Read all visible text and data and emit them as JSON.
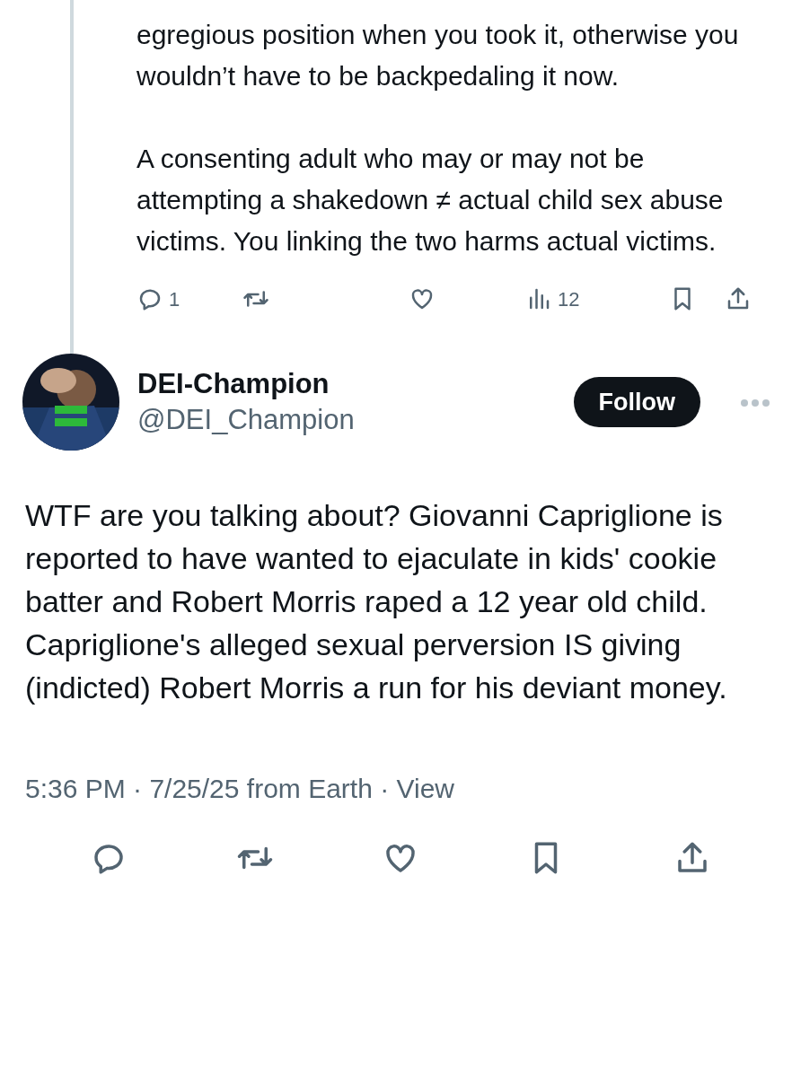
{
  "reply": {
    "paragraphs": [
      "egregious position when you took it, otherwise you wouldn’t have to be backpedaling it now.",
      "A consenting adult who may or may not be attempting a shakedown ≠ actual child sex abuse victims. You linking the two harms actual victims."
    ],
    "actions": [
      {
        "kind": "reply",
        "count": "1"
      },
      {
        "kind": "repost"
      },
      {
        "kind": "like"
      },
      {
        "kind": "views",
        "count": "12"
      },
      {
        "kind": "bookmark"
      },
      {
        "kind": "share"
      }
    ]
  },
  "post": {
    "author": {
      "name": "DEI-Champion",
      "handle": "@DEI_Champion"
    },
    "follow_label": "Follow",
    "text": "WTF are you talking about? Giovanni Capriglione is reported to have wanted to ejaculate in kids' cookie batter and Robert Morris raped a 12 year old child. Capriglione's alleged sexual perversion IS giving (indicted) Robert Morris a run for his deviant money.",
    "meta": "5:36 PM · 7/25/25 from Earth · View",
    "actions": [
      {
        "kind": "reply"
      },
      {
        "kind": "repost"
      },
      {
        "kind": "like"
      },
      {
        "kind": "bookmark"
      },
      {
        "kind": "share"
      }
    ]
  }
}
